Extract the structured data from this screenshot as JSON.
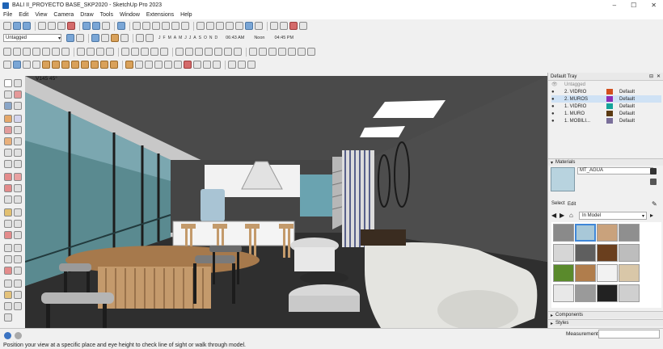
{
  "window": {
    "title": "BALI II_PROYECTO BASE_SKP2020 - SketchUp Pro 2023",
    "controls": [
      "–",
      "☐",
      "✕"
    ]
  },
  "menu": [
    "File",
    "Edit",
    "View",
    "Camera",
    "Draw",
    "Tools",
    "Window",
    "Extensions",
    "Help"
  ],
  "toolbar": {
    "tag_select": "Untagged",
    "months": [
      "J",
      "F",
      "M",
      "A",
      "M",
      "J",
      "J",
      "A",
      "S",
      "O",
      "N",
      "D"
    ],
    "time_start": "06:43 AM",
    "time_noon": "Noon",
    "time_end": "04:45 PM"
  },
  "viewport": {
    "scene_label": "V145 45°"
  },
  "tray": {
    "title": "Default Tray",
    "tags_partial": "Untagged",
    "tags": [
      {
        "name": "2. VIDRIO",
        "color": "#d2501e",
        "material": "Default",
        "selected": false
      },
      {
        "name": "2. MUROS",
        "color": "#8c2fb5",
        "material": "Default",
        "selected": true
      },
      {
        "name": "1. VIDRIO",
        "color": "#14a39b",
        "material": "Default",
        "selected": false
      },
      {
        "name": "1. MURO",
        "color": "#5b3a12",
        "material": "Default",
        "selected": false
      },
      {
        "name": "1. MOBILI...",
        "color": "#7a6f9a",
        "material": "Default",
        "selected": false
      }
    ],
    "materials": {
      "title": "Materials",
      "current_name": "MT_AGUA",
      "tab_select": "Select",
      "tab_edit": "Edit",
      "collection": "In Model",
      "swatch_colors": [
        "#8a8a8a",
        "#a8c8d8",
        "#c9a27c",
        "#8f8f8f",
        "#d6d6d6",
        "#5f5f5f",
        "#6a3f1e",
        "#bdbdbd",
        "#5a8a2c",
        "#b07d4c",
        "#f2f2f2",
        "#d9c7a8",
        "#e8e8e8",
        "#9a9a9a",
        "#222222",
        "#cfcfcf"
      ]
    },
    "components": "Components",
    "styles": "Styles"
  },
  "status": {
    "hint": "Position your view at a specific place and eye height to check line of sight or walk through model.",
    "measurements_label": "Measurements"
  }
}
